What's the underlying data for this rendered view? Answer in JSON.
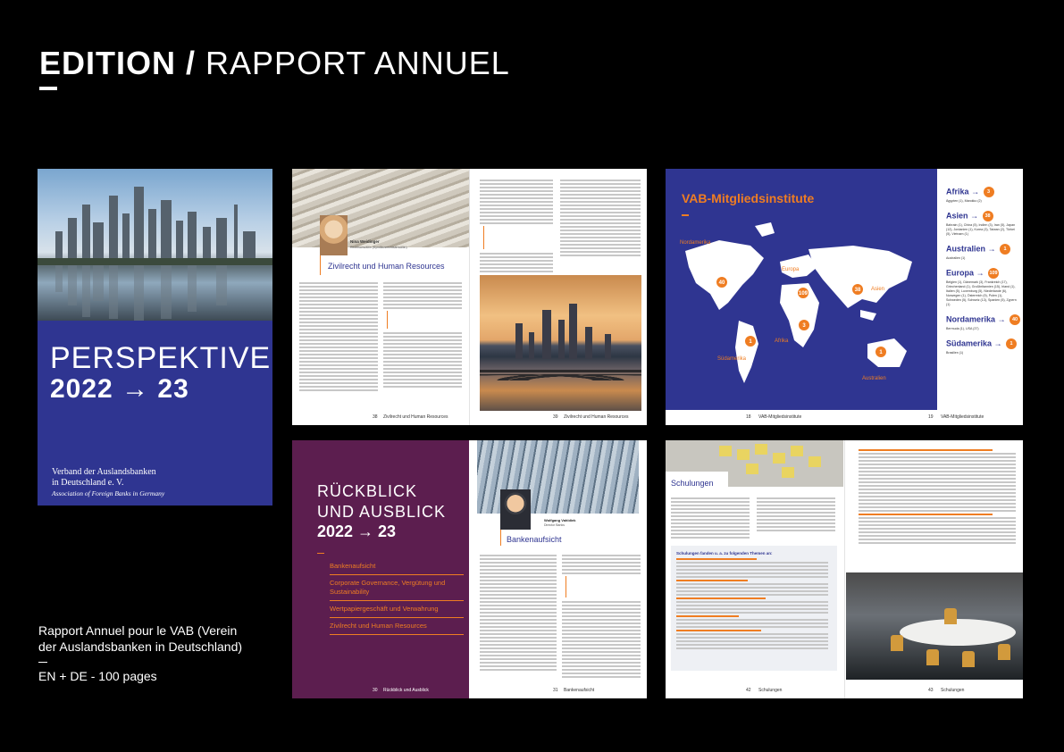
{
  "header": {
    "title_bold": "EDITION /",
    "title_light": "RAPPORT ANNUEL"
  },
  "caption": {
    "text": "Rapport Annuel pour le VAB (Verein der Auslandsbanken in Deutschland)",
    "details": "EN + DE - 100 pages"
  },
  "cover": {
    "title": "PERSPEKTIVEN",
    "year": "2022 → 23",
    "org_line1": "Verband der Auslandsbanken",
    "org_line2": "in Deutschland e. V.",
    "org_line3": "Association of Foreign Banks in Germany"
  },
  "spread1": {
    "person_name": "Nina Weidinger",
    "person_role": "Rechtsanwältin (Syndikusrechtsanwältin)",
    "section_title": "Zivilrecht und Human Resources",
    "page_left": "38",
    "page_right": "39",
    "footer_left": "Zivilrecht und Human Resources",
    "footer_right": "Zivilrecht und Human Resources"
  },
  "spread2": {
    "map_title": "VAB-Mitgliedsinstitute",
    "map_labels": {
      "nordamerika": "Nordamerika",
      "europa": "Europa",
      "asien": "Asien",
      "afrika": "Afrika",
      "suedamerika": "Südamerika",
      "australien": "Australien"
    },
    "pins": {
      "nordamerika": "40",
      "europa": "109",
      "asien": "38",
      "afrika": "3",
      "suedamerika": "1",
      "australien": "1"
    },
    "regions": [
      {
        "name": "Afrika →",
        "count": "3",
        "countries": "Ägypten (1), Marokko (2)"
      },
      {
        "name": "Asien →",
        "count": "38",
        "countries": "Bahrain (1), China (5), Indien (3), Iran (5), Japan (12), Jordanien (1), Korea (3), Taiwan (2), Türkei (5), Vietnam (1)"
      },
      {
        "name": "Australien →",
        "count": "1",
        "countries": "Australien (1)"
      },
      {
        "name": "Europa →",
        "count": "109",
        "countries": "Belgien (1), Dänemark (3), Frankreich (17), Griechenland (1), Großbritannien (15), Irland (1), Italien (5), Luxemburg (5), Niederlande (6), Norwegen (1), Österreich (9), Polen (1), Schweden (5), Schweiz (13), Spanien (5), Zypern (1)"
      },
      {
        "name": "Nordamerika →",
        "count": "40",
        "countries": "Bermuda (1), USA (37)"
      },
      {
        "name": "Südamerika →",
        "count": "1",
        "countries": "Brasilien (1)"
      }
    ],
    "page_left": "18",
    "page_right": "19",
    "footer_left": "VAB-Mitgliedsinstitute",
    "footer_right": "VAB-Mitgliedsinstitute"
  },
  "spread3": {
    "title_line1": "RÜCKBLICK",
    "title_line2": "UND AUSBLICK",
    "year": "2022 → 23",
    "toc": [
      "Bankenaufsicht",
      "Corporate Governance, Vergütung und Sustainability",
      "Wertpapiergeschäft und Verwahrung",
      "Zivilrecht und Human Resources"
    ],
    "person_name": "Wolfgang Vahldiek",
    "person_role": "Director Banks",
    "section_title": "Bankenaufsicht",
    "page_left": "30",
    "page_right": "31",
    "footer_left": "Rückblick und Ausblick",
    "footer_right": "Bankenaufsicht"
  },
  "spread4": {
    "section_title": "Schulungen",
    "box_heading": "Schulungen fanden u. a. zu folgenden Themen an:",
    "page_left": "42",
    "page_right": "43",
    "footer_left": "Schulungen",
    "footer_right": "Schulungen"
  },
  "colors": {
    "background": "#000000",
    "navy": "#2f3591",
    "orange": "#ef7d22",
    "plum": "#5c1e4f"
  }
}
